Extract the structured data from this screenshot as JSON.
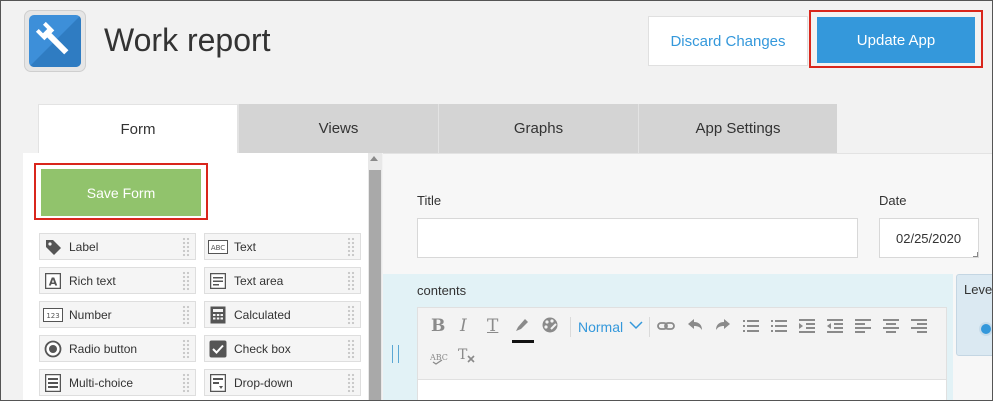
{
  "header": {
    "app_title": "Work report",
    "discard_label": "Discard Changes",
    "update_label": "Update App"
  },
  "tabs": [
    {
      "label": "Form",
      "active": true
    },
    {
      "label": "Views",
      "active": false
    },
    {
      "label": "Graphs",
      "active": false
    },
    {
      "label": "App Settings",
      "active": false
    }
  ],
  "palette": {
    "save_label": "Save Form",
    "items": [
      {
        "label": "Label",
        "icon": "tag-icon"
      },
      {
        "label": "Text",
        "icon": "abc-text-icon"
      },
      {
        "label": "Rich text",
        "icon": "rich-text-icon"
      },
      {
        "label": "Text area",
        "icon": "text-area-icon"
      },
      {
        "label": "Number",
        "icon": "number-icon"
      },
      {
        "label": "Calculated",
        "icon": "calculator-icon"
      },
      {
        "label": "Radio button",
        "icon": "radio-icon"
      },
      {
        "label": "Check box",
        "icon": "checkbox-icon"
      },
      {
        "label": "Multi-choice",
        "icon": "multi-choice-icon"
      },
      {
        "label": "Drop-down",
        "icon": "dropdown-icon"
      }
    ]
  },
  "form": {
    "title_label": "Title",
    "date_label": "Date",
    "date_value": "02/25/2020",
    "contents_label": "contents",
    "level_label": "Leve",
    "editor": {
      "format_value": "Normal",
      "tools": [
        "bold-icon",
        "italic-icon",
        "text-style-icon",
        "highlighter-icon",
        "palette-icon",
        "link-icon",
        "undo-icon",
        "redo-icon",
        "bullet-list-icon",
        "numbered-list-icon",
        "indent-icon",
        "outdent-icon",
        "align-left-icon",
        "align-center-icon",
        "align-right-icon",
        "spellcheck-icon",
        "clear-format-icon"
      ]
    }
  },
  "colors": {
    "primary": "#3498db",
    "save_green": "#91c36c",
    "highlight_red": "#d9261c"
  }
}
